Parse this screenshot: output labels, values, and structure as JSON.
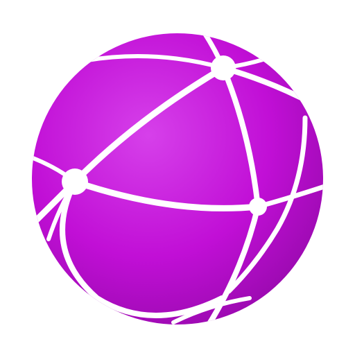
{
  "icon": {
    "name": "network-globe-icon",
    "colors": {
      "sphere": "#c10fd6",
      "sphere_shade": "#9b0ab0",
      "sphere_highlight": "#d640ea",
      "lines": "#ffffff",
      "background": "#ffffff"
    }
  }
}
